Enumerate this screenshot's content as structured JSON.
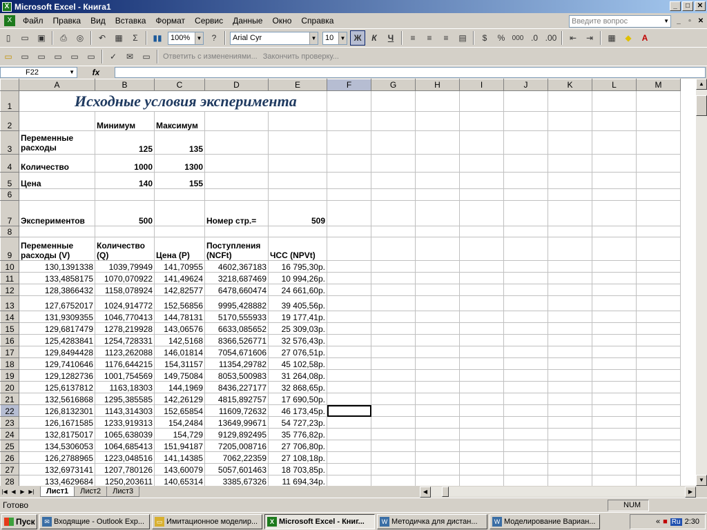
{
  "window": {
    "title": "Microsoft Excel - Книга1"
  },
  "menu": [
    "Файл",
    "Правка",
    "Вид",
    "Вставка",
    "Формат",
    "Сервис",
    "Данные",
    "Окно",
    "Справка"
  ],
  "help_box": {
    "placeholder": "Введите вопрос"
  },
  "toolbar": {
    "zoom": "100%",
    "font": "Arial Cyr",
    "size": "10",
    "bold": "Ж",
    "italic": "К",
    "underline": "Ч",
    "percent": "%",
    "thousands": "000"
  },
  "review_toolbar": {
    "reply": "Ответить с изменениями...",
    "end_review": "Закончить проверку..."
  },
  "formula_bar": {
    "name_box": "F22",
    "fx": "fx",
    "content": ""
  },
  "columns": [
    "A",
    "B",
    "C",
    "D",
    "E",
    "F",
    "G",
    "H",
    "I",
    "J",
    "K",
    "L",
    "M"
  ],
  "sheet": {
    "title": "Исходные условия эксперимента",
    "r2": {
      "b": "Минимум",
      "c": "Максимум"
    },
    "r3": {
      "a_line1": "Переменные",
      "a_line2": "расходы",
      "b": "125",
      "c": "135"
    },
    "r4": {
      "a": "Количество",
      "b": "1000",
      "c": "1300"
    },
    "r5": {
      "a": "Цена",
      "b": "140",
      "c": "155"
    },
    "r7": {
      "a": "Экспериментов",
      "b": "500",
      "d": "Номер стр.=",
      "e": "509"
    },
    "headers": {
      "a_line1": "Переменные",
      "a_line2": "расходы (V)",
      "b_line1": "Количество",
      "b_line2": "(Q)",
      "c": "Цена (P)",
      "d_line1": "Поступления",
      "d_line2": "(NCFt)",
      "e": "ЧСС (NPVt)"
    },
    "data": [
      [
        "10",
        "130,1391338",
        "1039,79949",
        "141,70955",
        "4602,367183",
        "16 795,30р."
      ],
      [
        "11",
        "133,4858175",
        "1070,070922",
        "141,49624",
        "3218,687469",
        "10 994,26р."
      ],
      [
        "12",
        "128,3866432",
        "1158,078924",
        "142,82577",
        "6478,660474",
        "24 661,60р."
      ],
      [
        "13",
        "127,6752017",
        "1024,914772",
        "152,56856",
        "9995,428882",
        "39 405,56р."
      ],
      [
        "14",
        "131,9309355",
        "1046,770413",
        "144,78131",
        "5170,555933",
        "19 177,41р."
      ],
      [
        "15",
        "129,6817479",
        "1278,219928",
        "143,06576",
        "6633,085652",
        "25 309,03р."
      ],
      [
        "16",
        "125,4283841",
        "1254,728331",
        "142,5168",
        "8366,526771",
        "32 576,43р."
      ],
      [
        "17",
        "129,8494428",
        "1123,262088",
        "146,01814",
        "7054,671606",
        "27 076,51р."
      ],
      [
        "18",
        "129,7410646",
        "1176,644215",
        "154,31157",
        "11354,29782",
        "45 102,58р."
      ],
      [
        "19",
        "129,1282736",
        "1001,754569",
        "149,75084",
        "8053,500983",
        "31 264,08р."
      ],
      [
        "20",
        "125,6137812",
        "1163,18303",
        "144,1969",
        "8436,227177",
        "32 868,65р."
      ],
      [
        "21",
        "132,5616868",
        "1295,385585",
        "142,26129",
        "4815,892757",
        "17 690,50р."
      ],
      [
        "22",
        "126,8132301",
        "1143,314303",
        "152,65854",
        "11609,72632",
        "46 173,45р."
      ],
      [
        "23",
        "126,1671585",
        "1233,919313",
        "154,2484",
        "13649,99671",
        "54 727,23р."
      ],
      [
        "24",
        "132,8175017",
        "1065,638039",
        "154,729",
        "9129,892495",
        "35 776,82р."
      ],
      [
        "25",
        "134,5306053",
        "1064,685413",
        "151,94187",
        "7205,008716",
        "27 706,80р."
      ],
      [
        "26",
        "126,2788965",
        "1223,048516",
        "141,14385",
        "7062,22359",
        "27 108,18р."
      ],
      [
        "27",
        "132,6973141",
        "1207,780126",
        "143,60079",
        "5057,601463",
        "18 703,85р."
      ],
      [
        "28",
        "133,4629684",
        "1250,203611",
        "140,65314",
        "3385,67326",
        "11 694,34р."
      ]
    ]
  },
  "sheet_tabs": [
    "Лист1",
    "Лист2",
    "Лист3"
  ],
  "status": {
    "text": "Готово",
    "num": "NUM"
  },
  "taskbar": {
    "start": "Пуск",
    "tasks": [
      "Входящие - Outlook Exp...",
      "Имитационное моделир...",
      "Microsoft Excel - Книг...",
      "Методичка для дистан...",
      "Моделирование Вариан..."
    ],
    "lang": "Ru",
    "clock": "2:30"
  }
}
